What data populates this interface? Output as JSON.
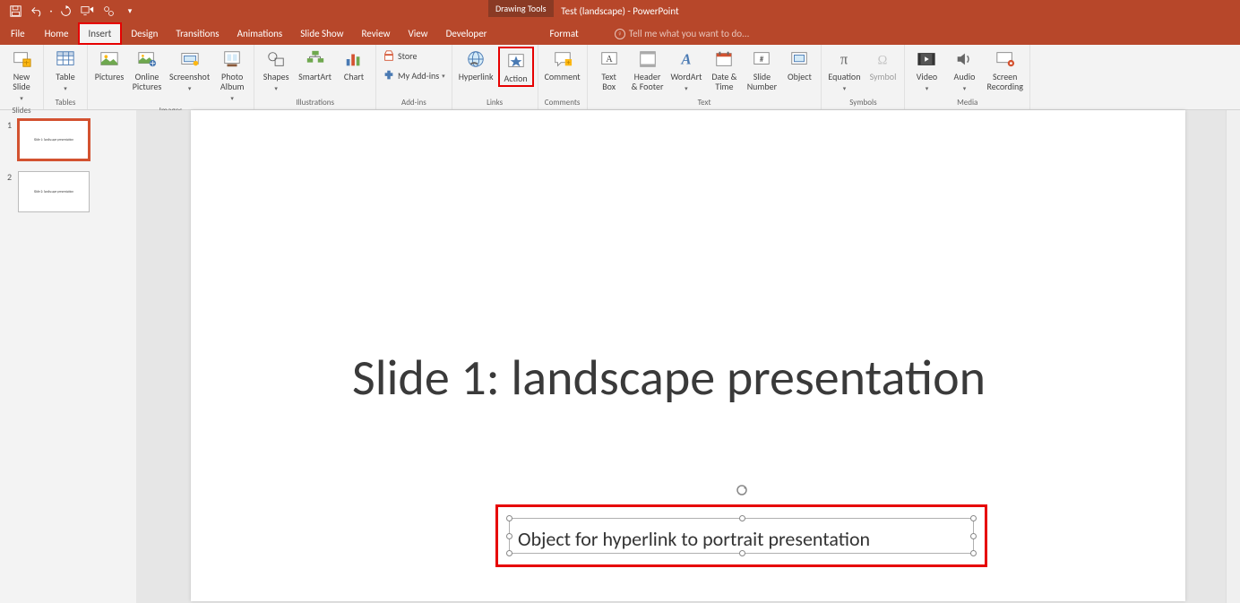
{
  "app_title": "Test (landscape) - PowerPoint",
  "context_tab": "Drawing Tools",
  "tabs": {
    "file": "File",
    "home": "Home",
    "insert": "Insert",
    "design": "Design",
    "transitions": "Transitions",
    "animations": "Animations",
    "slideshow": "Slide Show",
    "review": "Review",
    "view": "View",
    "developer": "Developer",
    "format": "Format"
  },
  "tellme": "Tell me what you want to do...",
  "ribbon": {
    "slides": {
      "new_slide": "New\nSlide",
      "group": "Slides"
    },
    "tables": {
      "table": "Table",
      "group": "Tables"
    },
    "images": {
      "pictures": "Pictures",
      "online": "Online\nPictures",
      "screenshot": "Screenshot",
      "photo": "Photo\nAlbum",
      "group": "Images"
    },
    "illus": {
      "shapes": "Shapes",
      "smartart": "SmartArt",
      "chart": "Chart",
      "group": "Illustrations"
    },
    "addins": {
      "store": "Store",
      "my": "My Add-ins",
      "group": "Add-ins"
    },
    "links": {
      "hyperlink": "Hyperlink",
      "action": "Action",
      "group": "Links"
    },
    "comments": {
      "comment": "Comment",
      "group": "Comments"
    },
    "text": {
      "textbox": "Text\nBox",
      "header": "Header\n& Footer",
      "wordart": "WordArt",
      "datetime": "Date &\nTime",
      "slidenum": "Slide\nNumber",
      "object": "Object",
      "group": "Text"
    },
    "symbols": {
      "equation": "Equation",
      "symbol": "Symbol",
      "group": "Symbols"
    },
    "media": {
      "video": "Video",
      "audio": "Audio",
      "screenrec": "Screen\nRecording",
      "group": "Media"
    }
  },
  "thumbs": {
    "s1_num": "1",
    "s1_text": "Slide 1: landscape presentation",
    "s2_num": "2",
    "s2_text": "Slide 2: landscape presentation"
  },
  "slide": {
    "title": "Slide 1:  landscape presentation",
    "selected_text": "Object for hyperlink to portrait presentation"
  }
}
